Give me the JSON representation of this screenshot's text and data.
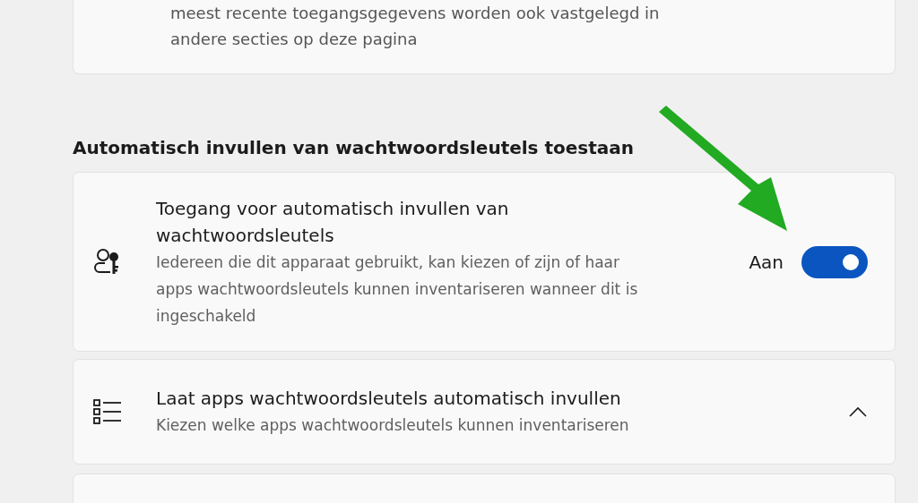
{
  "top_card": {
    "description": "meest recente toegangsgegevens worden ook vastgelegd in andere secties op deze pagina"
  },
  "section": {
    "heading": "Automatisch invullen van wachtwoordsleutels toestaan"
  },
  "settings": [
    {
      "kind": "toggle",
      "title": "Toegang voor automatisch invullen van wachtwoordsleutels",
      "description": "Iedereen die dit apparaat gebruikt, kan kiezen of zijn of haar apps wachtwoordsleutels kunnen inventariseren wanneer dit is ingeschakeld",
      "state_label": "Aan",
      "on": true
    },
    {
      "kind": "expander",
      "title": "Laat apps wachtwoordsleutels automatisch invullen",
      "description": "Kiezen welke apps wachtwoordsleutels kunnen inventariseren",
      "expanded": true
    }
  ]
}
